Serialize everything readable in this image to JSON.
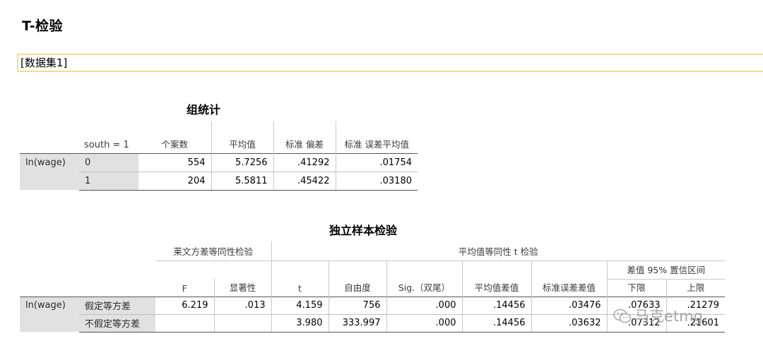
{
  "page": {
    "title": "T-检验",
    "dataset": "[数据集1]"
  },
  "group_stats": {
    "title": "组统计",
    "headers": {
      "group_var": "south = 1",
      "n": "个案数",
      "mean": "平均值",
      "sd": "标准 偏差",
      "se": "标准 误差平均值"
    },
    "var_label": "ln(wage)",
    "rows": [
      {
        "group": "0",
        "n": "554",
        "mean": "5.7256",
        "sd": ".41292",
        "se": ".01754"
      },
      {
        "group": "1",
        "n": "204",
        "mean": "5.5811",
        "sd": ".45422",
        "se": ".03180"
      }
    ]
  },
  "ttest": {
    "title": "独立样本检验",
    "levene_header": "莱文方差等同性检验",
    "ttest_header": "平均值等同性 t 检验",
    "ci_header": "差值 95% 置信区间",
    "col_headers": {
      "F": "F",
      "sig": "显著性",
      "t": "t",
      "df": "自由度",
      "sig2": "Sig.（双尾）",
      "md": "平均值差值",
      "sed": "标准误差差值",
      "lower": "下限",
      "upper": "上限"
    },
    "var_label": "ln(wage)",
    "rows": [
      {
        "label": "假定等方差",
        "F": "6.219",
        "sig": ".013",
        "t": "4.159",
        "df": "756",
        "sig2": ".000",
        "md": ".14456",
        "sed": ".03476",
        "lower": ".07633",
        "upper": ".21279"
      },
      {
        "label": "不假定等方差",
        "F": "",
        "sig": "",
        "t": "3.980",
        "df": "333.997",
        "sig2": ".000",
        "md": ".14456",
        "sed": ".03632",
        "lower": ".07312",
        "upper": ".21601"
      }
    ]
  },
  "watermark": {
    "text": "马克etmg",
    "icon": "wechat-icon"
  }
}
